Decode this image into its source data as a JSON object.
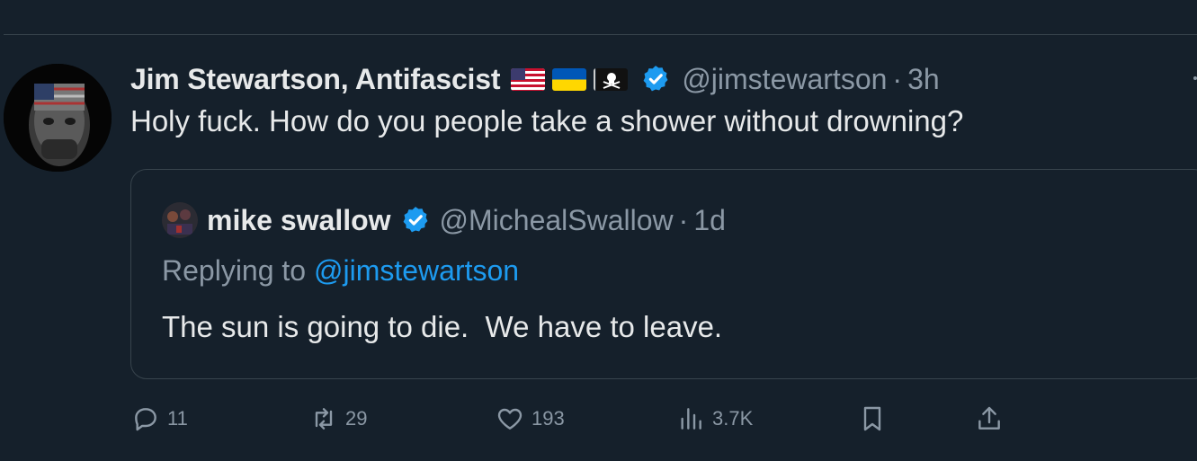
{
  "tweet": {
    "display_name": "Jim Stewartson, Antifascist",
    "flags": [
      "us-flag-icon",
      "ukraine-flag-icon",
      "pirate-flag-icon"
    ],
    "handle": "@jimstewartson",
    "separator": "·",
    "time": "3h",
    "text": "Holy fuck. How do you people take a shower without drowning?"
  },
  "quote": {
    "display_name": "mike swallow",
    "handle": "@MichealSwallow",
    "separator": "·",
    "time": "1d",
    "replying_prefix": "Replying to ",
    "replying_handle": "@jimstewartson",
    "text": "The sun is going to die.  We have to leave."
  },
  "actions": {
    "reply_count": "11",
    "retweet_count": "29",
    "like_count": "193",
    "views_count": "3.7K"
  },
  "colors": {
    "background": "#15202b",
    "border": "#38444d",
    "text_primary": "#e7e9ea",
    "text_secondary": "#8b98a5",
    "accent": "#1d9bf0"
  }
}
